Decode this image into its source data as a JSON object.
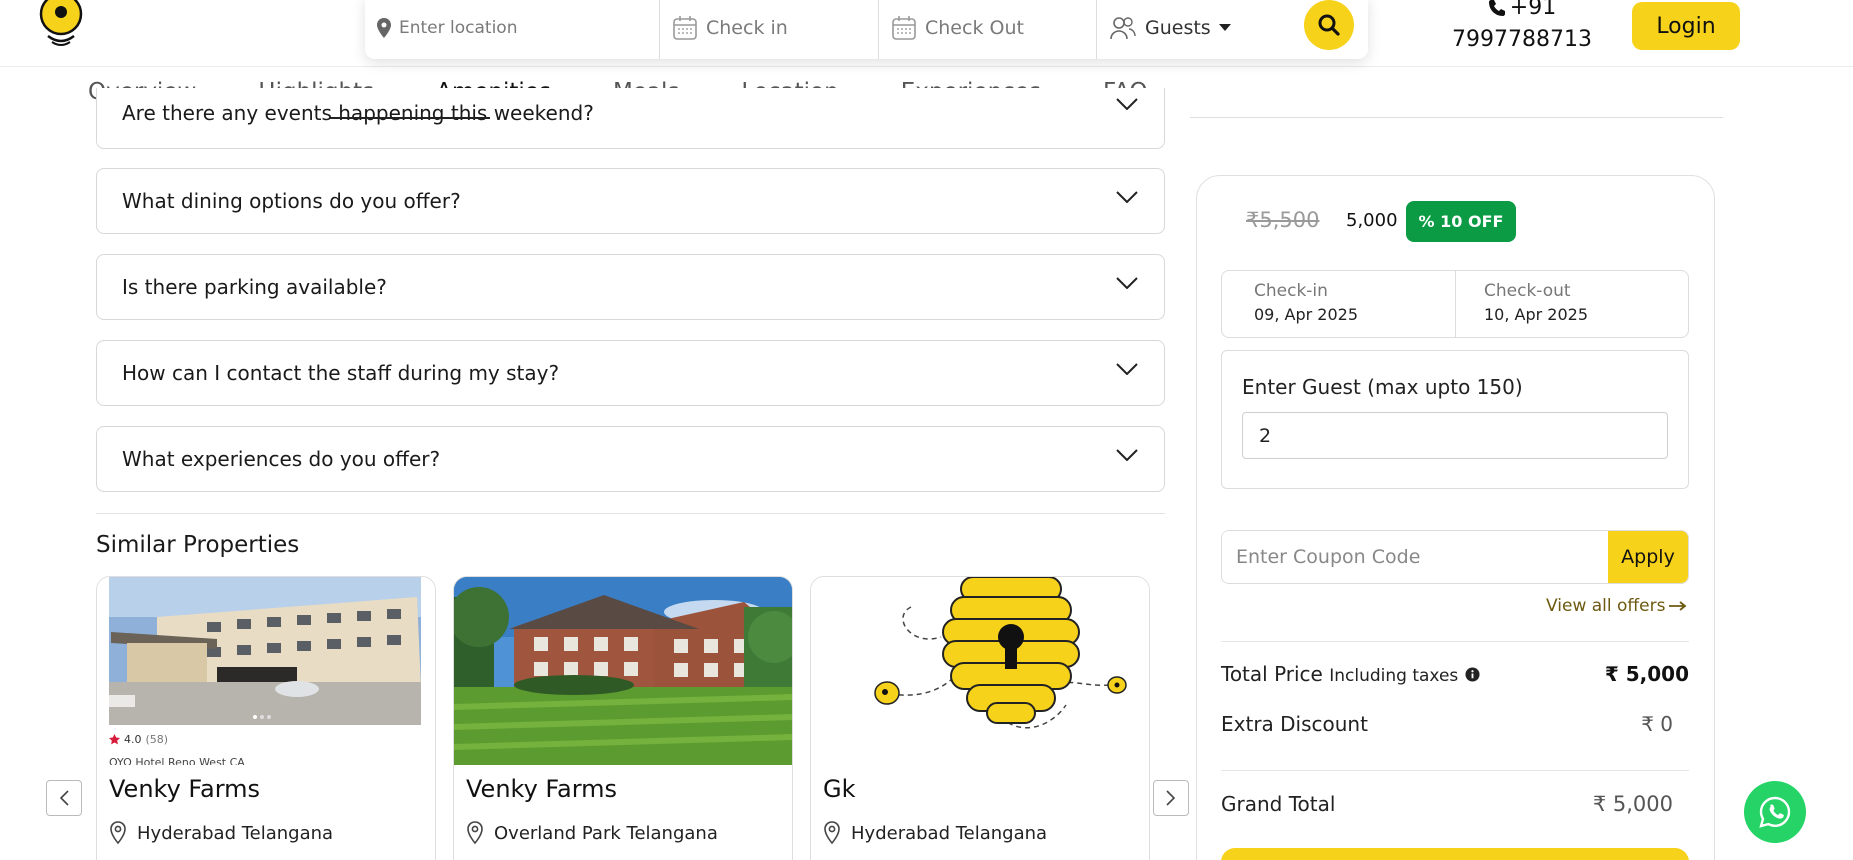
{
  "header": {
    "search": {
      "location_placeholder": "Enter location",
      "checkin_label": "Check in",
      "checkout_label": "Check Out",
      "guests_label": "Guests"
    },
    "phone_line1": "+91",
    "phone_line2": "7997788713",
    "login_label": "Login"
  },
  "tabs": [
    {
      "label": "Overview"
    },
    {
      "label": "Highlights"
    },
    {
      "label": "Amenities"
    },
    {
      "label": "Meals"
    },
    {
      "label": "Location"
    },
    {
      "label": "Experiences"
    },
    {
      "label": "FAQ"
    }
  ],
  "faq": {
    "items": [
      {
        "question": "Are there any events happening this weekend?"
      },
      {
        "question": "What dining options do you offer?"
      },
      {
        "question": "Is there parking available?"
      },
      {
        "question": "How can I contact the staff during my stay?"
      },
      {
        "question": "What experiences do you offer?"
      }
    ]
  },
  "similar": {
    "title": "Similar Properties",
    "cards": [
      {
        "name": "Venky Farms",
        "location": "Hyderabad Telangana",
        "rating": "4.0",
        "reviews": "(58)",
        "caption": "OYO Hotel Reno West CA"
      },
      {
        "name": "Venky Farms",
        "location": "Overland Park Telangana"
      },
      {
        "name": "Gk",
        "location": "Hyderabad Telangana"
      }
    ]
  },
  "booking": {
    "original_price": "₹5,500",
    "price": "5,000",
    "discount_badge": "% 10 OFF",
    "checkin_label": "Check-in",
    "checkin_date": "09, Apr 2025",
    "checkout_label": "Check-out",
    "checkout_date": "10, Apr 2025",
    "guest_label": "Enter Guest (max upto 150)",
    "guest_value": "2",
    "coupon_placeholder": "Enter Coupon Code",
    "apply_label": "Apply",
    "view_offers": "View all offers",
    "total_label": "Total Price",
    "total_note": "Including taxes",
    "total_value": "₹ 5,000",
    "discount_label": "Extra Discount",
    "discount_value": "₹ 0",
    "grand_label": "Grand Total",
    "grand_value": "₹ 5,000"
  },
  "colors": {
    "brand_yellow": "#f7d21b",
    "discount_green": "#0b9b45",
    "whatsapp_green": "#25d366"
  }
}
